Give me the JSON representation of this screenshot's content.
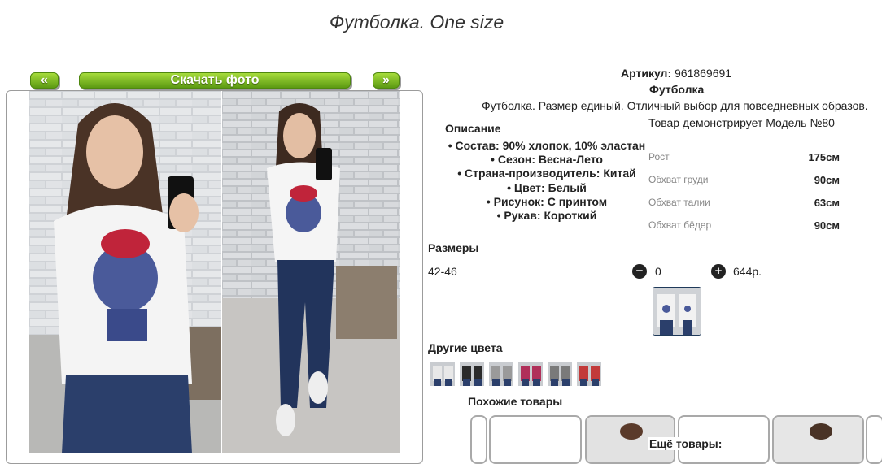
{
  "page": {
    "title": "Футболка. One size"
  },
  "gallery": {
    "prev_label": "«",
    "next_label": "»",
    "download_label": "Скачать фото"
  },
  "product": {
    "article_label": "Артикул:",
    "article_value": "961869691",
    "name": "Футболка",
    "description": "Футболка. Размер единый. Отличный выбор для повседневных образов.",
    "description_heading": "Описание",
    "specs": [
      "Состав: 90% хлопок, 10% эластан",
      "Сезон: Весна-Лето",
      "Страна-производитель: Китай",
      "Цвет: Белый",
      "Рисунок: С принтом",
      "Рукав: Короткий"
    ]
  },
  "model": {
    "title": "Товар демонстрирует Модель №80",
    "measurements": [
      {
        "label": "Рост",
        "value": "175см"
      },
      {
        "label": "Обхват груди",
        "value": "90см"
      },
      {
        "label": "Обхват талии",
        "value": "63см"
      },
      {
        "label": "Обхват бёдер",
        "value": "90см"
      }
    ]
  },
  "sizes": {
    "heading": "Размеры",
    "range": "42-46",
    "minus_icon": "minus-circle-icon",
    "quantity": "0",
    "plus_icon": "plus-circle-icon",
    "price": "644р."
  },
  "other_colors": {
    "heading": "Другие цвета",
    "swatches": [
      "#e8e8e8",
      "#2b2b2b",
      "#9a9a9a",
      "#b0305a",
      "#7a7a7a",
      "#c23a3a"
    ]
  },
  "similar": {
    "heading": "Похожие товары",
    "more_label": "Ещё товары:"
  },
  "colors": {
    "accent_green_top": "#a6dc3c",
    "accent_green_bottom": "#5c9a12",
    "dark": "#222222"
  }
}
